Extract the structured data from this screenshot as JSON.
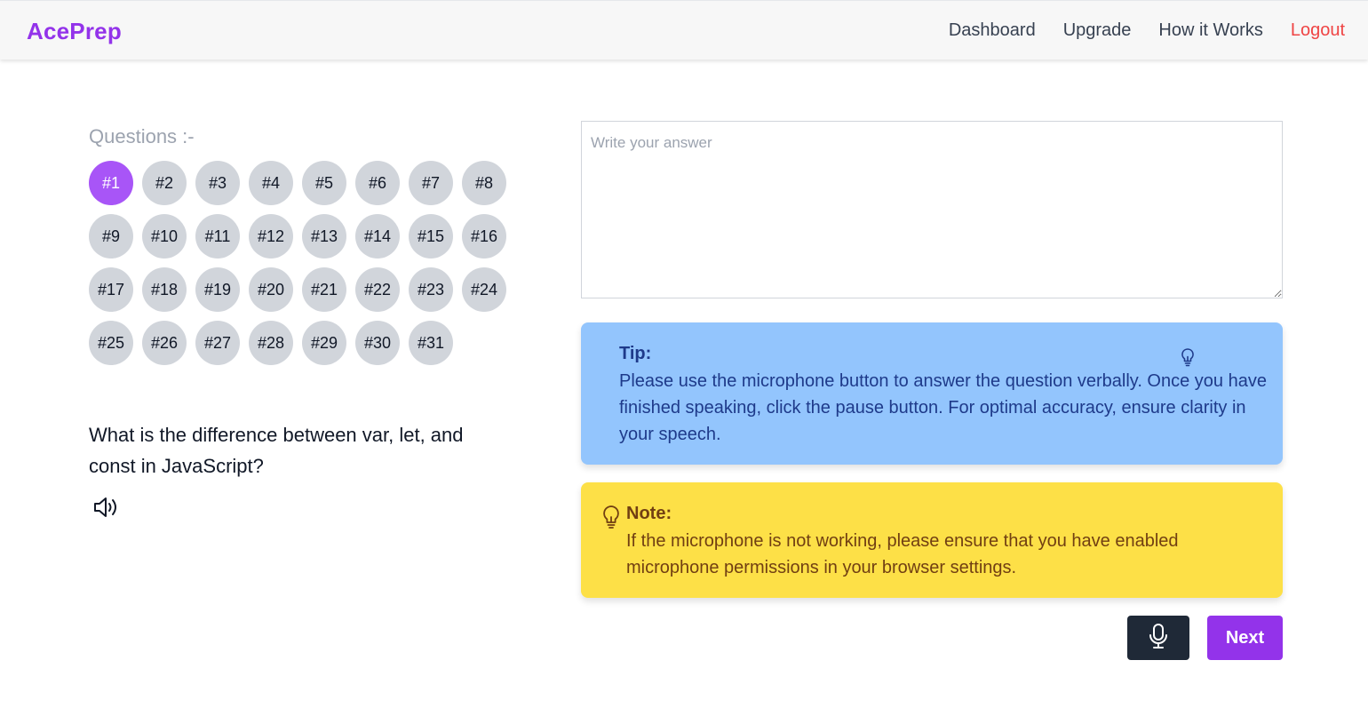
{
  "navbar": {
    "brand": "AcePrep",
    "links": [
      "Dashboard",
      "Upgrade",
      "How it Works"
    ],
    "logout": "Logout"
  },
  "questions": {
    "label": "Questions :-",
    "active_index": 0,
    "items": [
      "#1",
      "#2",
      "#3",
      "#4",
      "#5",
      "#6",
      "#7",
      "#8",
      "#9",
      "#10",
      "#11",
      "#12",
      "#13",
      "#14",
      "#15",
      "#16",
      "#17",
      "#18",
      "#19",
      "#20",
      "#21",
      "#22",
      "#23",
      "#24",
      "#25",
      "#26",
      "#27",
      "#28",
      "#29",
      "#30",
      "#31"
    ]
  },
  "current_question": {
    "text": "What is the difference between var, let, and const in JavaScript?",
    "icon": "speaker-icon"
  },
  "answer": {
    "placeholder": "Write your answer",
    "value": ""
  },
  "tip": {
    "title": "Tip:",
    "body": "Please use the microphone button to answer the question verbally. Once you have finished speaking, click the pause button. For optimal accuracy, ensure clarity in your speech.",
    "icon": "lightbulb-icon",
    "color": "#93c5fd"
  },
  "note": {
    "title": "Note:",
    "body": "If the microphone is not working, please ensure that you have enabled microphone permissions in your browser settings.",
    "icon": "lightbulb-icon",
    "color": "#fde047"
  },
  "actions": {
    "mic_icon": "microphone-icon",
    "next_label": "Next"
  },
  "colors": {
    "accent": "#9333ea",
    "active_question": "#a855f7",
    "logout": "#ef4444"
  }
}
